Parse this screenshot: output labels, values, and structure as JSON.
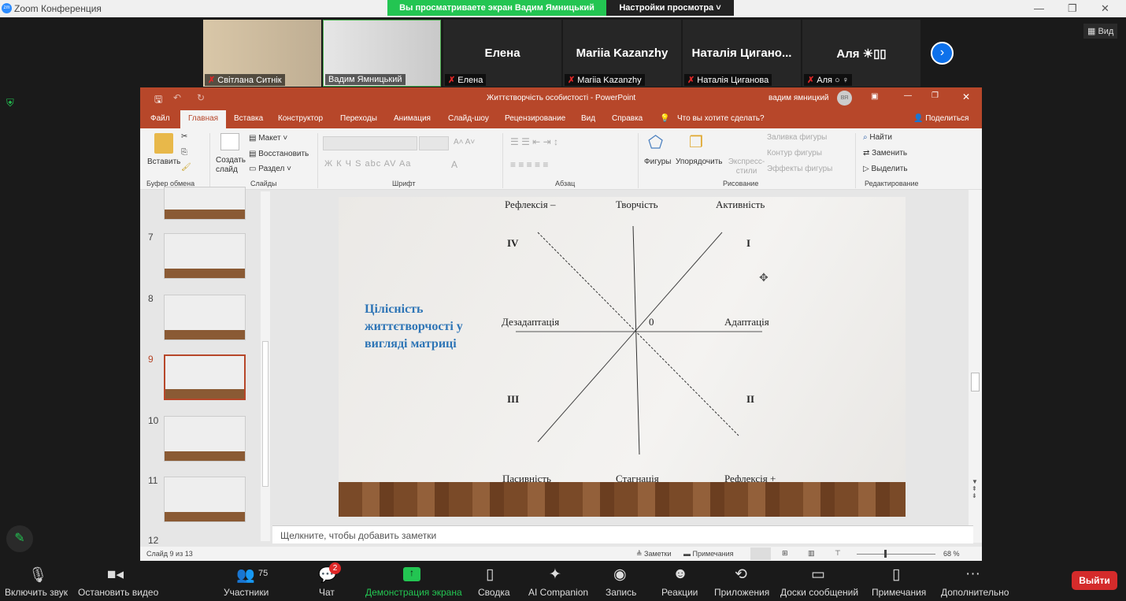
{
  "zoom": {
    "title": "Zoom Конференция",
    "banner": "Вы просматриваете экран Вадим Ямницький",
    "view_settings": "Настройки просмотра",
    "view_btn": "Вид",
    "participants": [
      {
        "label": "Світлана Ситнік",
        "name": ""
      },
      {
        "label": "Вадим Ямницький",
        "name": ""
      },
      {
        "label": "Елена",
        "name": "Елена"
      },
      {
        "label": "Mariia Kazanzhy",
        "name": "Mariia Kazanzhy"
      },
      {
        "label": "Наталія Циганова",
        "name": "Наталія Цигано..."
      },
      {
        "label": "Аля ○ ♀",
        "name": "Аля ☀▯▯"
      }
    ],
    "toolbar": {
      "mute": "Включить звук",
      "video": "Остановить видео",
      "participants": "Участники",
      "participants_count": "75",
      "chat": "Чат",
      "chat_badge": "2",
      "share": "Демонстрация экрана",
      "summary": "Сводка",
      "ai": "AI Companion",
      "record": "Запись",
      "reactions": "Реакции",
      "apps": "Приложения",
      "whiteboards": "Доски сообщений",
      "notes": "Примечания",
      "more": "Дополнительно",
      "leave": "Выйти"
    }
  },
  "ppt": {
    "title": "Життєтворчість особистості  -  PowerPoint",
    "user": "вадим ямницкий",
    "avatar": "ВЯ",
    "tabs": [
      "Файл",
      "Главная",
      "Вставка",
      "Конструктор",
      "Переходы",
      "Анимация",
      "Слайд-шоу",
      "Рецензирование",
      "Вид",
      "Справка"
    ],
    "search": "Что вы хотите сделать?",
    "share": "Поделиться",
    "ribbon": {
      "paste": "Вставить",
      "new_slide": "Создать слайд",
      "layout": "Макет",
      "reset": "Восстановить",
      "section": "Раздел",
      "shapes": "Фигуры",
      "arrange": "Упорядочить",
      "styles": "Экспресс-стили",
      "fill": "Заливка фигуры",
      "outline": "Контур фигуры",
      "effects": "Эффекты фигуры",
      "find": "Найти",
      "replace": "Заменить",
      "select": "Выделить",
      "font_btns": "Ж  К  Ч  S  abc  AV  Aa",
      "groups": [
        "Буфер обмена",
        "Слайды",
        "Шрифт",
        "Абзац",
        "Рисование",
        "Редактирование"
      ]
    },
    "thumbs": [
      "7",
      "8",
      "9",
      "10",
      "11",
      "12"
    ],
    "active_slide": "9",
    "notes_placeholder": "Щелкните, чтобы добавить заметки",
    "status": {
      "slide": "Слайд 9 из 13",
      "notes": "Заметки",
      "comments": "Примечания",
      "zoom": "68 %"
    }
  },
  "slide": {
    "title": "Цілісність життєтворчості у вигляді матриці",
    "top": [
      "Рефлексія –",
      "Творчість",
      "Активність"
    ],
    "bottom": [
      "Пасивність",
      "Стагнація",
      "Рефлексія +"
    ],
    "left": "Дезадаптація",
    "right": "Адаптація",
    "origin": "0",
    "quadrants": [
      "I",
      "II",
      "III",
      "IV"
    ]
  }
}
